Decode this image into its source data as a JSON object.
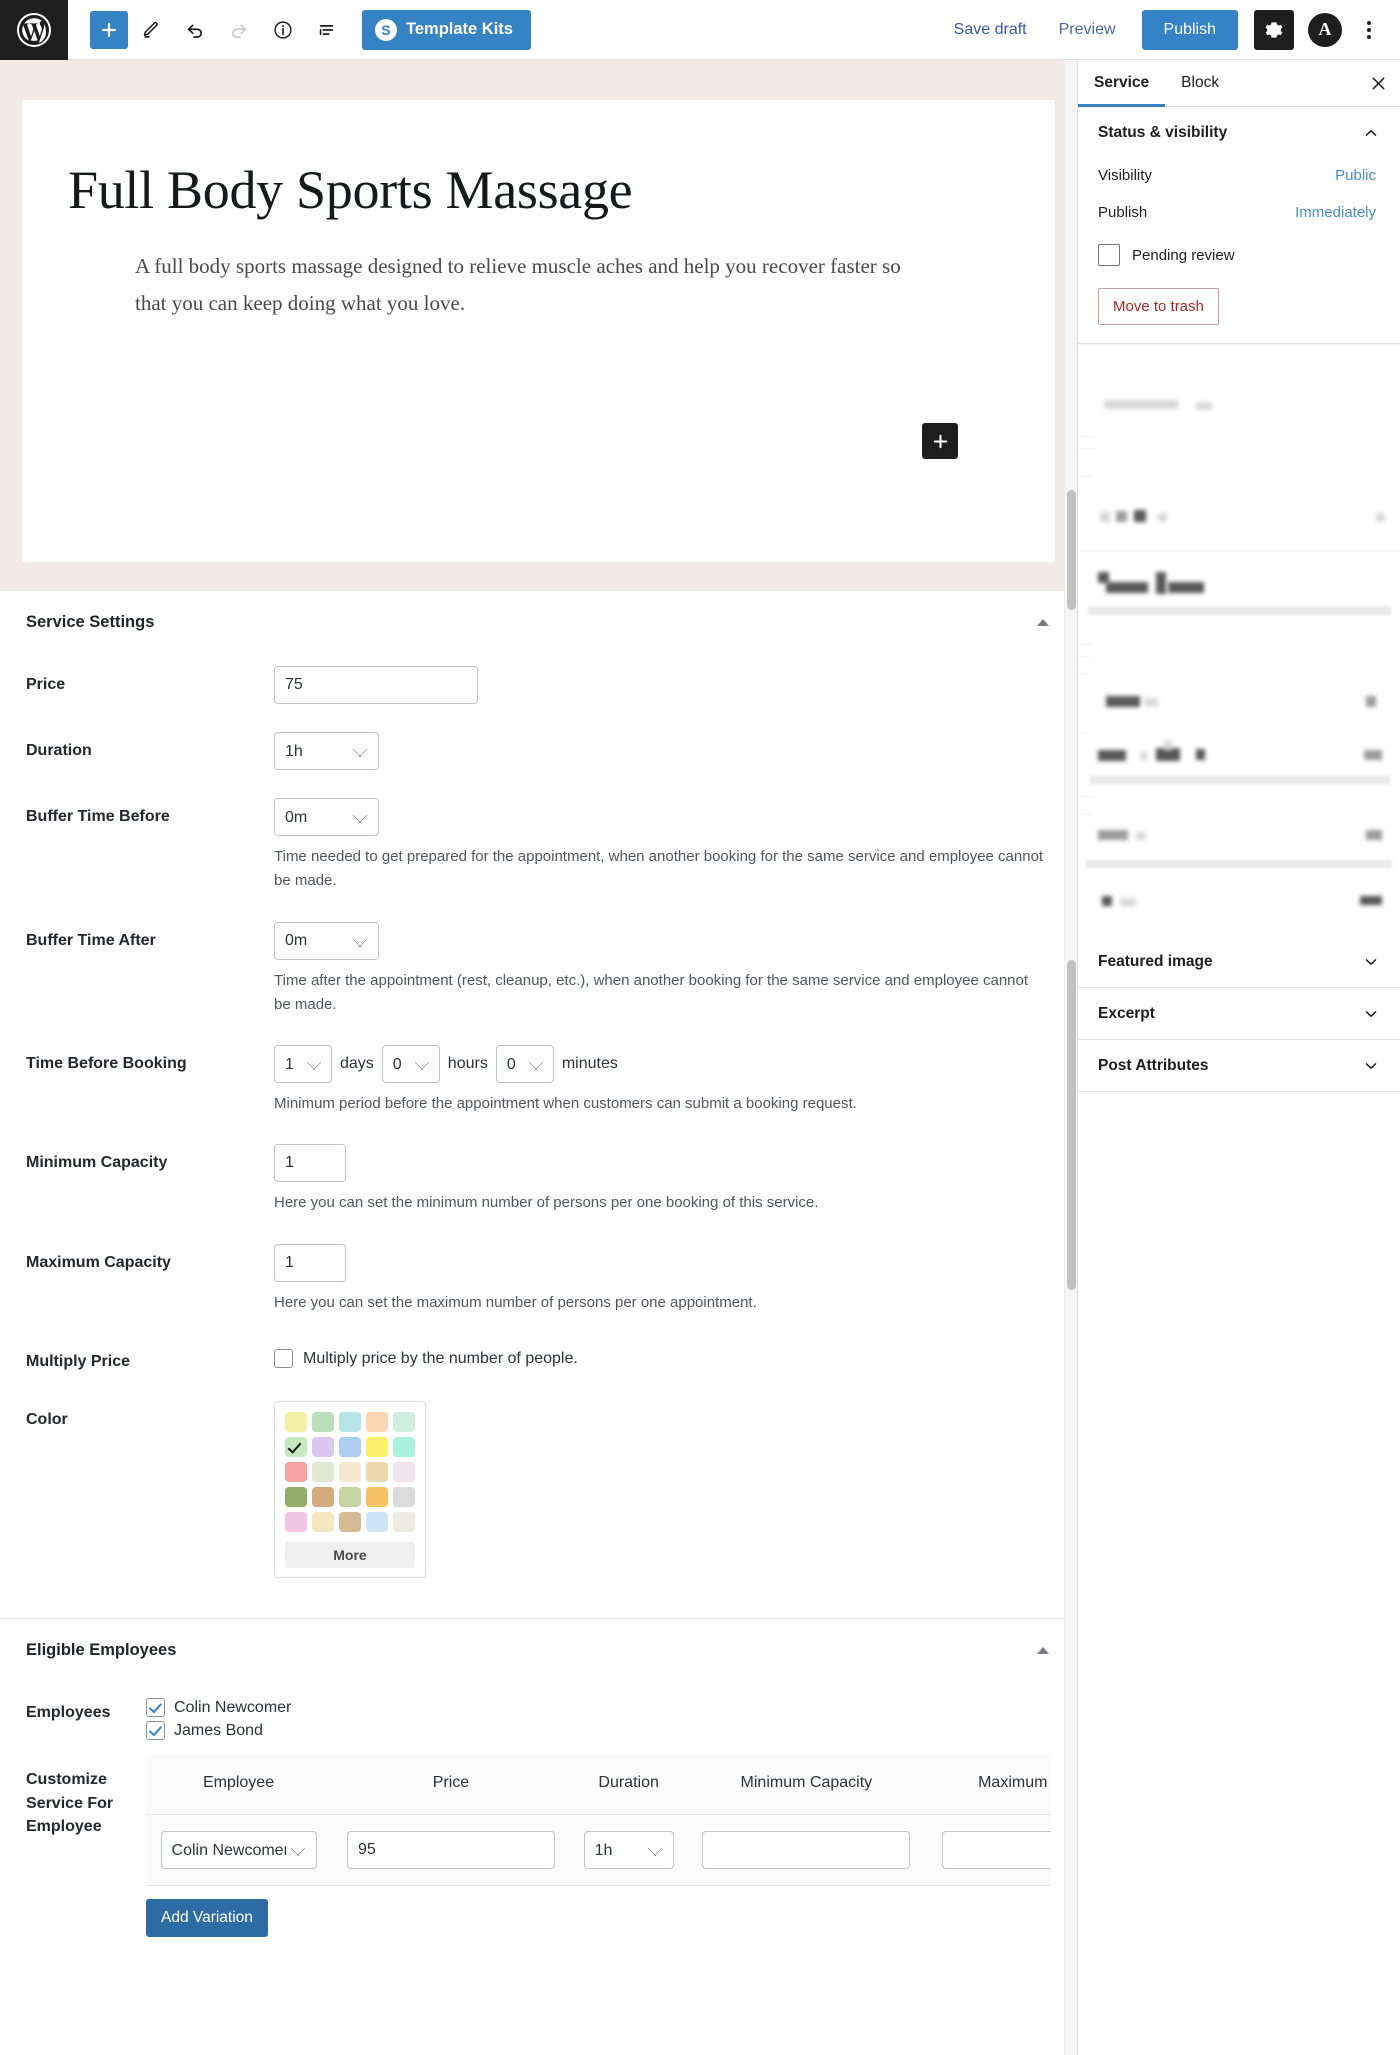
{
  "toolbar": {
    "logo_icon": "wordpress-logo-icon",
    "add_block_icon": "plus-icon",
    "add_block_label": "+",
    "edit_tool_icon": "pencil-icon",
    "undo_icon": "undo-arrow-icon",
    "redo_icon": "redo-arrow-icon",
    "details_icon": "info-circle-icon",
    "list_view_icon": "list-view-icon",
    "template_kits_label": "Template Kits",
    "template_kits_badge": "S",
    "save_draft_label": "Save draft",
    "preview_label": "Preview",
    "publish_label": "Publish",
    "settings_icon": "gear-icon",
    "account_avatar_label": "A",
    "options_icon": "kebab-menu-icon"
  },
  "editor": {
    "title": "Full Body Sports Massage",
    "paragraph": "A full body sports massage designed to relieve muscle aches and help you recover faster so that you can keep doing what you love.",
    "block_inserter_label": "+"
  },
  "service_settings": {
    "panel_title": "Service Settings",
    "collapse_icon": "caret-up-icon",
    "price": {
      "label": "Price",
      "value": "75"
    },
    "duration": {
      "label": "Duration",
      "value": "1h"
    },
    "buffer_before": {
      "label": "Buffer Time Before",
      "value": "0m",
      "help": "Time needed to get prepared for the appointment, when another booking for the same service and employee cannot be made."
    },
    "buffer_after": {
      "label": "Buffer Time After",
      "value": "0m",
      "help": "Time after the appointment (rest, cleanup, etc.), when another booking for the same service and employee cannot be made."
    },
    "time_before_booking": {
      "label": "Time Before Booking",
      "days_value": "1",
      "days_unit": "days",
      "hours_value": "0",
      "hours_unit": "hours",
      "minutes_value": "0",
      "minutes_unit": "minutes",
      "help": "Minimum period before the appointment when customers can submit a booking request."
    },
    "minimum_capacity": {
      "label": "Minimum Capacity",
      "value": "1",
      "help": "Here you can set the minimum number of persons per one booking of this service."
    },
    "maximum_capacity": {
      "label": "Maximum Capacity",
      "value": "1",
      "help": "Here you can set the maximum number of persons per one appointment."
    },
    "multiply_price": {
      "label": "Multiply Price",
      "checkbox_label": "Multiply price by the number of people.",
      "checked": false
    },
    "color": {
      "label": "Color",
      "more_label": "More",
      "selected_index": 5,
      "swatches": [
        "#f5f0a8",
        "#b9dfbb",
        "#b6e4e8",
        "#fbd6b4",
        "#cdeee0",
        "#c6e9c0",
        "#d9c9f2",
        "#aecdf0",
        "#f9f06b",
        "#a9f2dc",
        "#f8a3a3",
        "#e0e8d4",
        "#f7e9cf",
        "#ecd9b0",
        "#f0e4ea",
        "#93ad68",
        "#d4ab7c",
        "#c6d4a4",
        "#f6c064",
        "#dcdcdc",
        "#f0c4e2",
        "#f5e7c0",
        "#d4bb93",
        "#cfe4f6",
        "#ecece0"
      ]
    }
  },
  "eligible_employees": {
    "panel_title": "Eligible Employees",
    "collapse_icon": "caret-up-icon",
    "employees_label": "Employees",
    "employees": [
      {
        "name": "Colin Newcomer",
        "checked": true
      },
      {
        "name": "James Bond",
        "checked": true
      }
    ],
    "customize_label": "Customize Service For Employee",
    "table": {
      "headers": [
        "Employee",
        "Price",
        "Duration",
        "Minimum Capacity",
        "Maximum Capacity"
      ],
      "rows": [
        {
          "employee": "Colin Newcomer",
          "price": "95",
          "duration": "1h",
          "minimum_capacity": "",
          "maximum_capacity": ""
        }
      ]
    },
    "add_variation_label": "Add Variation"
  },
  "sidebar": {
    "tabs": [
      {
        "label": "Service",
        "active": true
      },
      {
        "label": "Block",
        "active": false
      }
    ],
    "close_icon": "close-icon",
    "status_visibility": {
      "title": "Status & visibility",
      "chevron": "chevron-up-icon",
      "visibility_label": "Visibility",
      "visibility_value": "Public",
      "publish_label": "Publish",
      "publish_value": "Immediately",
      "pending_review_label": "Pending review",
      "pending_review_checked": false,
      "move_to_trash_label": "Move to trash"
    },
    "panels": [
      {
        "title": "Featured image",
        "chevron": "chevron-down-icon"
      },
      {
        "title": "Excerpt",
        "chevron": "chevron-down-icon"
      },
      {
        "title": "Post Attributes",
        "chevron": "chevron-down-icon"
      }
    ]
  }
}
